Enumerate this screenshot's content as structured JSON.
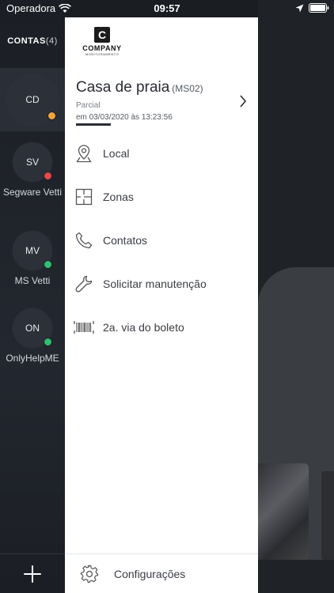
{
  "status_bar": {
    "carrier": "Operadora",
    "time": "09:57"
  },
  "rail": {
    "title": "CONTAS",
    "count": "(4)",
    "accounts": [
      {
        "initials": "CD",
        "name": "",
        "status_color": "#f0a33a",
        "active": true
      },
      {
        "initials": "SV",
        "name": "Segware Vetti",
        "status_color": "#e5484d",
        "active": false
      },
      {
        "initials": "MV",
        "name": "MS Vetti",
        "status_color": "#2fbf71",
        "active": false
      },
      {
        "initials": "ON",
        "name": "OnlyHelpME",
        "status_color": "#2fbf71",
        "active": false
      }
    ],
    "add_icon": "plus-icon"
  },
  "drawer": {
    "logo": {
      "text": "COMPANY",
      "sub": "MONITORAMENTO"
    },
    "site": {
      "name": "Casa de praia",
      "code": "(MS02)",
      "state": "Parcial",
      "date": "em 03/03/2020 às 13:23:56"
    },
    "menu": [
      {
        "label": "Local",
        "icon": "location-pin-icon"
      },
      {
        "label": "Zonas",
        "icon": "floorplan-icon"
      },
      {
        "label": "Contatos",
        "icon": "phone-icon"
      },
      {
        "label": "Solicitar manutenção",
        "icon": "wrench-icon"
      },
      {
        "label": "2a. via do boleto",
        "icon": "barcode-icon"
      }
    ],
    "footer": {
      "label": "Configurações",
      "icon": "gear-icon"
    }
  }
}
